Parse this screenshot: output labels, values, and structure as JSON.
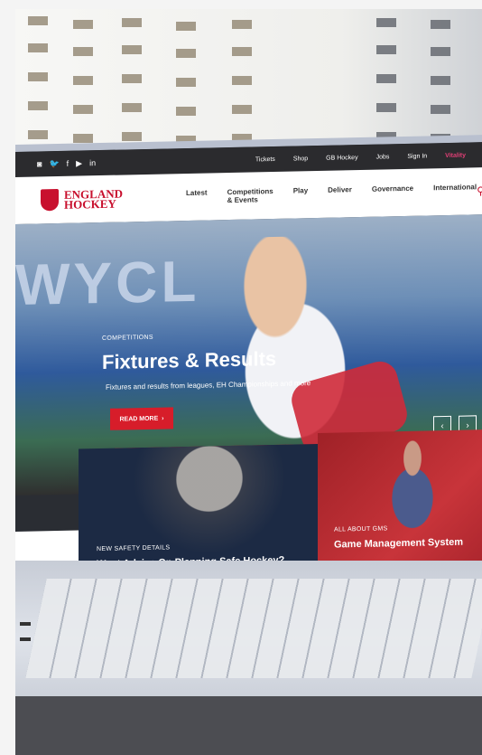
{
  "site": {
    "logo_line1": "ENGLAND",
    "logo_line2": "HOCKEY"
  },
  "utility_bar": {
    "social_icons": [
      "instagram-icon",
      "twitter-icon",
      "facebook-icon",
      "youtube-icon",
      "linkedin-icon"
    ],
    "social_glyphs": [
      "◙",
      "🐦",
      "f",
      "▶",
      "in"
    ],
    "links": [
      "Tickets",
      "Shop",
      "GB Hockey",
      "Jobs",
      "Sign In"
    ],
    "vitality": "Vitality"
  },
  "nav": {
    "items": [
      "Latest",
      "Competitions & Events",
      "Play",
      "Deliver",
      "Governance",
      "International"
    ],
    "search_icon": "search-icon"
  },
  "hero": {
    "background_text": "WYCL",
    "kicker": "COMPETITIONS",
    "title": "Fixtures & Results",
    "subtitle": "Fixtures and results from leagues, EH Championships and more",
    "cta": "READ MORE",
    "prev": "‹",
    "next": "›"
  },
  "cards": [
    {
      "kicker": "NEW SAFETY DETAILS",
      "title": "Want Advice On Planning Safe Hockey?"
    },
    {
      "kicker": "ALL ABOUT GMS",
      "title": "Game Management System"
    }
  ],
  "colors": {
    "brand_red": "#c8102e",
    "utility_bar": "#2b2b2e"
  }
}
